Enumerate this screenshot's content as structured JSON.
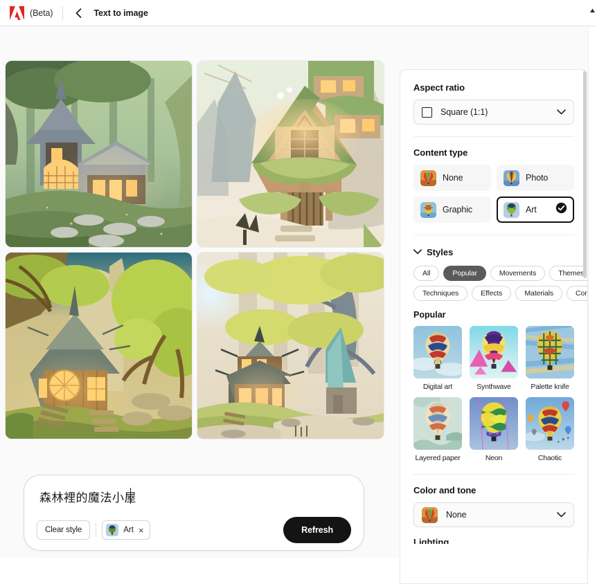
{
  "header": {
    "logo_icon": "adobe-logo",
    "beta_label": "(Beta)",
    "back_icon": "chevron-left-icon",
    "title": "Text to image"
  },
  "results": {
    "images": [
      {
        "alt": "Fantasy forest cottage with glowing windows and stone path"
      },
      {
        "alt": "Moss covered timber treehouse cottage in misty forest"
      },
      {
        "alt": "Round window cottage with conical slate roof and wooden steps"
      },
      {
        "alt": "Pagoda style cottage with teal roofed shed among pale trees"
      }
    ]
  },
  "prompt": {
    "text": "森林裡的魔法小屋",
    "clear_style_label": "Clear style",
    "style_chip_label": "Art",
    "style_chip_remove_icon": "close-icon",
    "refresh_label": "Refresh"
  },
  "panel": {
    "aspect_ratio": {
      "title": "Aspect ratio",
      "icon": "square-icon",
      "value": "Square (1:1)",
      "chevron_icon": "chevron-down-icon"
    },
    "content_type": {
      "title": "Content type",
      "options": [
        {
          "label": "None",
          "selected": false
        },
        {
          "label": "Photo",
          "selected": false
        },
        {
          "label": "Graphic",
          "selected": false
        },
        {
          "label": "Art",
          "selected": true,
          "check_icon": "check-circle-icon"
        }
      ]
    },
    "styles": {
      "title": "Styles",
      "collapse_icon": "chevron-down-icon",
      "filters": [
        {
          "label": "All",
          "active": false
        },
        {
          "label": "Popular",
          "active": true
        },
        {
          "label": "Movements",
          "active": false
        },
        {
          "label": "Themes",
          "active": false
        },
        {
          "label": "Techniques",
          "active": false
        },
        {
          "label": "Effects",
          "active": false
        },
        {
          "label": "Materials",
          "active": false
        },
        {
          "label": "Concepts",
          "active": false
        }
      ],
      "group_title": "Popular",
      "items": [
        {
          "label": "Digital art"
        },
        {
          "label": "Synthwave"
        },
        {
          "label": "Palette knife"
        },
        {
          "label": "Layered paper"
        },
        {
          "label": "Neon"
        },
        {
          "label": "Chaotic"
        }
      ]
    },
    "color_and_tone": {
      "title": "Color and tone",
      "value": "None",
      "chevron_icon": "chevron-down-icon"
    },
    "next_section_title": "Lighting"
  },
  "colors": {
    "accent_black": "#141414",
    "adobe_red": "#e1251b",
    "panel_bg": "#ffffff",
    "page_bg": "#fafafa",
    "pill_active_bg": "#5a5a5a"
  }
}
